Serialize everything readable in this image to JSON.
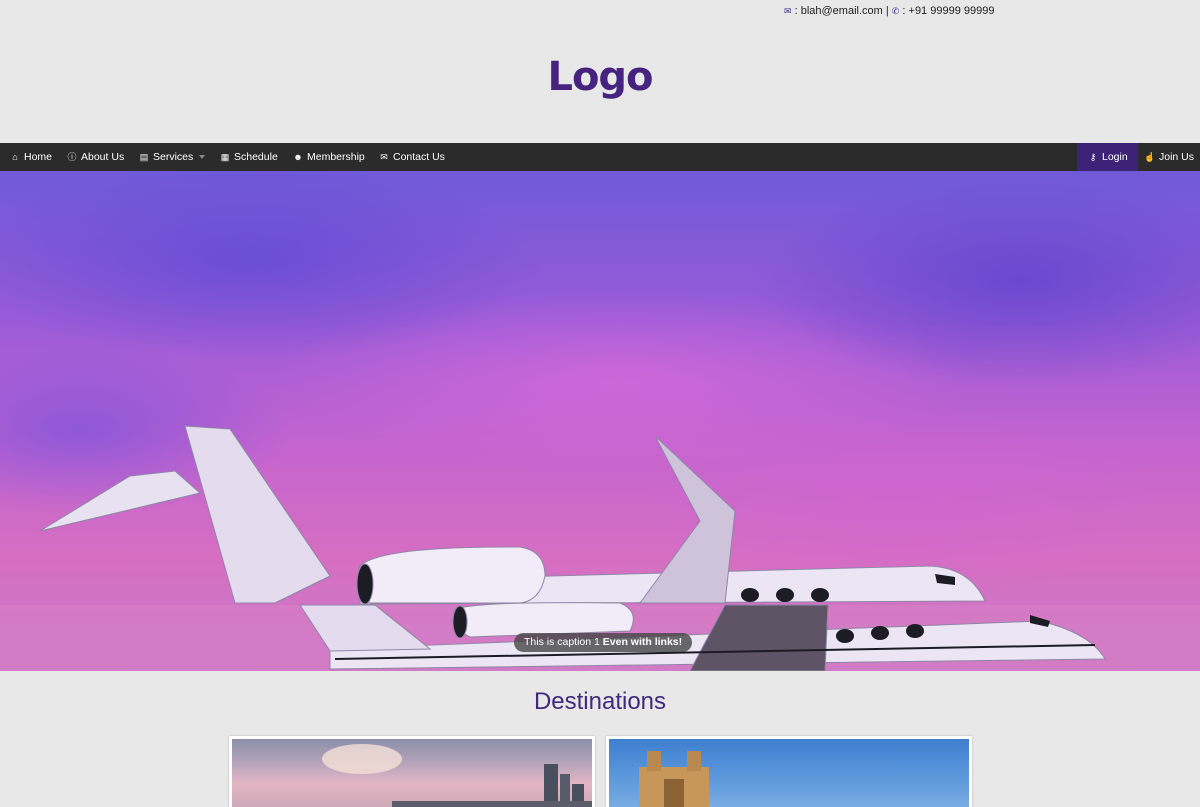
{
  "contact": {
    "email_icon": "envelope-icon",
    "email": ": blah@email.com |",
    "phone_icon": "phone-icon",
    "phone": ": +91 99999 99999"
  },
  "logo": "Logo",
  "nav": {
    "left": [
      {
        "label": "Home",
        "icon": "home-icon",
        "glyph": "⌂"
      },
      {
        "label": "About Us",
        "icon": "info-icon",
        "glyph": "ⓘ"
      },
      {
        "label": "Services",
        "icon": "clipboard-icon",
        "glyph": "▤",
        "has_dropdown": true
      },
      {
        "label": "Schedule",
        "icon": "calendar-icon",
        "glyph": "▦"
      },
      {
        "label": "Membership",
        "icon": "users-icon",
        "glyph": "☻"
      },
      {
        "label": "Contact Us",
        "icon": "envelope-icon",
        "glyph": "✉"
      }
    ],
    "right": [
      {
        "label": "Login",
        "icon": "key-icon",
        "glyph": "⚷",
        "active": true
      },
      {
        "label": "Join Us",
        "icon": "thumbs-up-icon",
        "glyph": "☝"
      }
    ]
  },
  "hero": {
    "caption_plain": "This is caption 1 ",
    "caption_link": "Even with links!"
  },
  "destinations": {
    "title": "Destinations"
  },
  "colors": {
    "accent": "#45237f",
    "nav_bg": "#2b2b2b",
    "login_bg": "#3d2378",
    "page_bg": "#e8e8e8"
  }
}
